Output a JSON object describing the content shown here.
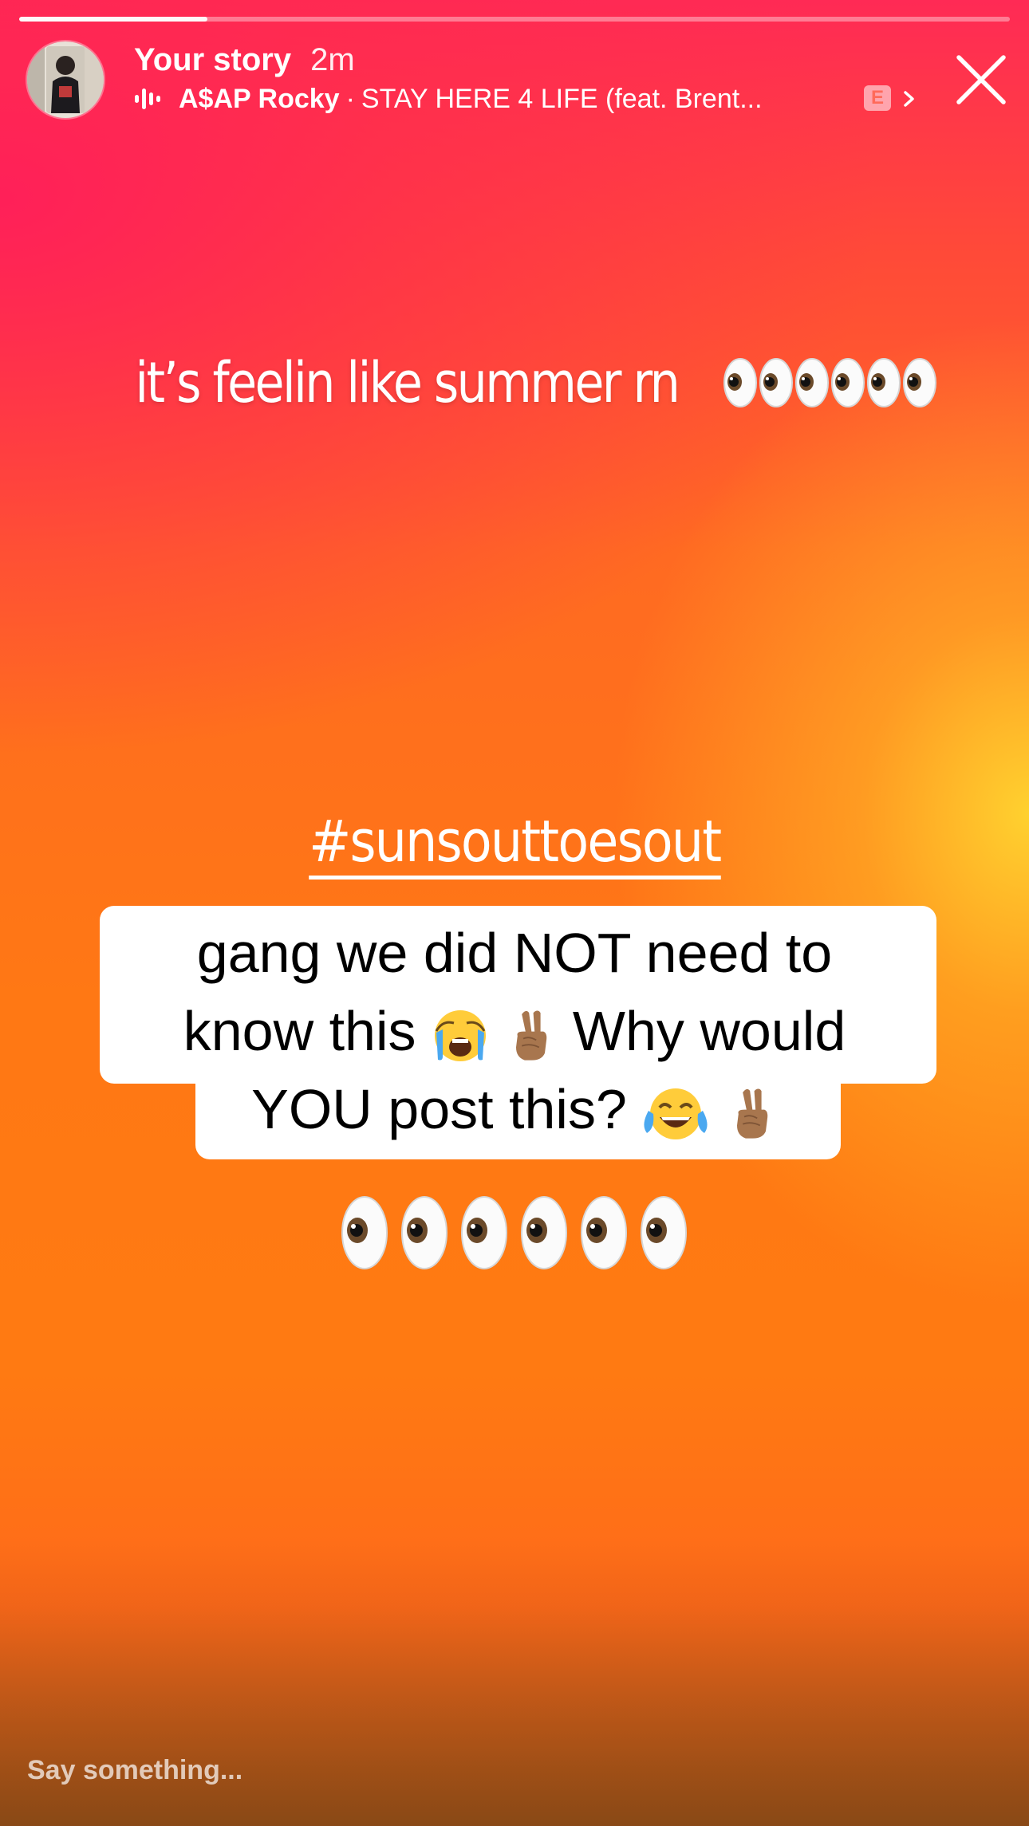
{
  "progress": {
    "fraction": 0.19
  },
  "header": {
    "story_label": "Your story",
    "time_ago": "2m",
    "music": {
      "artist": "A$AP Rocky",
      "separator": "·",
      "title": "STAY HERE 4 LIFE (feat. Brent...",
      "explicit_badge": "E"
    }
  },
  "caption": {
    "text": "it’s feelin like summer rn"
  },
  "hashtag": {
    "text": "#sunsouttoesout"
  },
  "comment": {
    "line1": "gang we did NOT need to",
    "line2_a": "know this",
    "line2_b": " Why would",
    "line3": "YOU post this?"
  },
  "reply": {
    "placeholder": "Say something..."
  },
  "icons": [
    "music-wave-icon",
    "explicit-icon",
    "chevron-right-icon",
    "close-icon",
    "eyes-emoji",
    "loudly-crying-emoji",
    "victory-hand-emoji",
    "tears-of-joy-emoji"
  ]
}
